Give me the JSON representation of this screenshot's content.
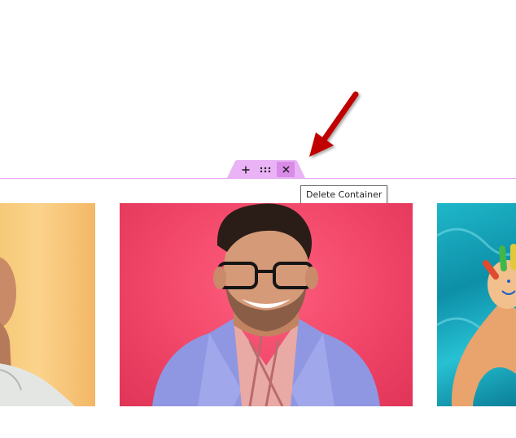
{
  "canvas": {
    "background": "#ffffff",
    "container_border_color": "#e7a6f2"
  },
  "container_handle": {
    "color": "#e9b3f5",
    "active_color": "#d98be8",
    "buttons": [
      {
        "icon": "plus-icon",
        "glyph": "+",
        "action": "Add Container"
      },
      {
        "icon": "drag-handle-icon",
        "glyph": "∷",
        "action": "Move Container"
      },
      {
        "icon": "close-icon",
        "glyph": "✕",
        "action": "Delete Container"
      }
    ]
  },
  "tooltip": {
    "text": "Delete Container"
  },
  "annotation_arrow": {
    "color": "#c00000",
    "points_to": "delete-container-button"
  },
  "gallery": {
    "images": [
      {
        "name": "portrait-left-yellow-background",
        "background": "#f9c67a"
      },
      {
        "name": "portrait-smiling-man-glasses-pink-background",
        "background": "#f14668"
      },
      {
        "name": "portrait-painted-hand-pool-background",
        "background": "#1fb7c9"
      }
    ]
  }
}
